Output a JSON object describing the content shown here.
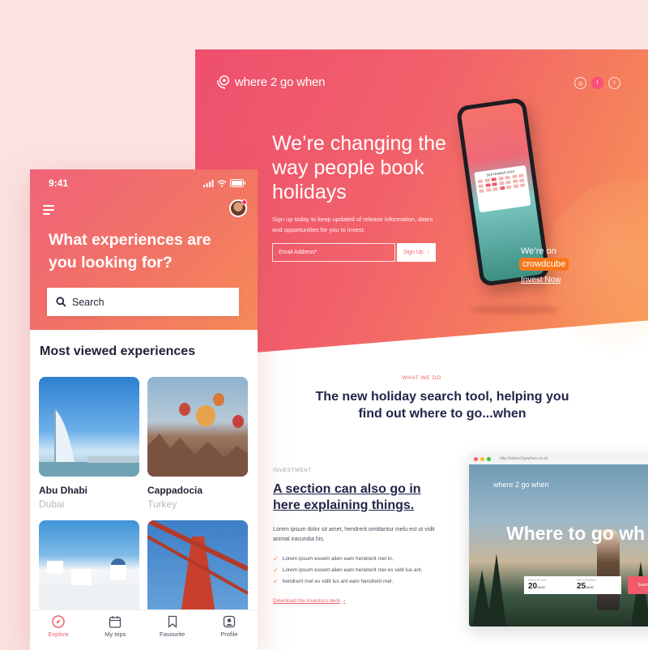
{
  "desktop": {
    "brand": "where 2 go when",
    "socials": [
      "◎",
      "f",
      "t"
    ],
    "hero_title": "We’re changing the way people book holidays",
    "hero_sub": "Sign up today to keep updated of release information, dates and opportunities for you to invest.",
    "email_placeholder": "Email Address*",
    "signup_label": "Sign Up",
    "phone_cal_title": "SEPTEMBER 2019",
    "crowdcube_on": "We’re on",
    "crowdcube": "crowdcube",
    "invest_link": "Invest Now",
    "what_kicker": "WHAT WE DO",
    "what_title": "The new holiday search tool, helping you find out where to go...when",
    "inv_kicker": "INVESTMENT",
    "inv_title": "A section can also go in here explaining things.",
    "inv_body": "Lorem ipsum dolor sit amet, hendrerit omittantur melu est ut vidit animal iracundia his.",
    "checks": [
      "Lorem ipsum essent alien eam hendrerit mel in.",
      "Lorem ipsum essent alien eam hendrerit mel es vidit lus anl.",
      "hendrerit mel es vidit lus anl eam hendrerit mel."
    ],
    "download_link": "Download the investors deck",
    "browser": {
      "url": "http://where2gowhen.co.uk",
      "brand": "where 2 go when",
      "headline": "Where to go wh",
      "departing_label": "DEPARTING",
      "departing_day": "20",
      "departing_month": "/AUG",
      "returning_label": "RETURNING",
      "returning_day": "25",
      "returning_month": "/AUG",
      "button": "Search"
    }
  },
  "mobile": {
    "time": "9:41",
    "title": "What experiences are you looking for?",
    "search_placeholder": "Search",
    "section_title": "Most viewed experiences",
    "cards": [
      {
        "name": "Abu Dhabi",
        "sub": "Dubai"
      },
      {
        "name": "Cappadocia",
        "sub": "Turkey"
      },
      {
        "name": "",
        "sub": ""
      },
      {
        "name": "",
        "sub": ""
      }
    ],
    "tabs": [
      {
        "label": "Explore",
        "icon": "compass-icon"
      },
      {
        "label": "My trips",
        "icon": "calendar-icon"
      },
      {
        "label": "Favourite",
        "icon": "bookmark-icon"
      },
      {
        "label": "Profile",
        "icon": "profile-icon"
      }
    ]
  },
  "colors": {
    "accent": "#f0606a",
    "orange": "#f58a58",
    "navy": "#22264a",
    "background": "#fbe3e2"
  }
}
